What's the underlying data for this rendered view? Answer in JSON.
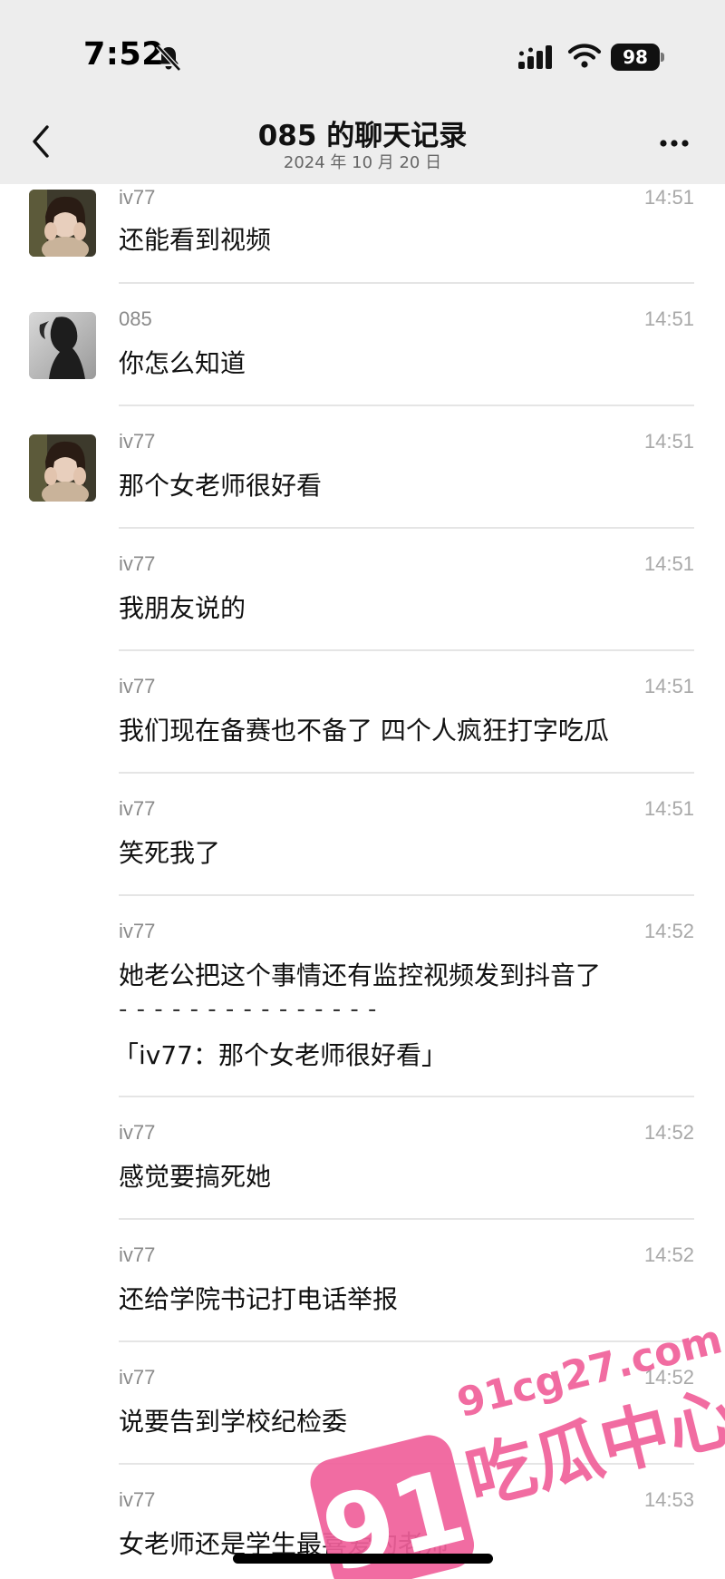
{
  "status_bar": {
    "time": "7:52",
    "battery": "98"
  },
  "header": {
    "title": "085 的聊天记录",
    "date": "2024 年 10 月 20 日"
  },
  "messages": [
    {
      "sender": "iv77",
      "time": "14:51",
      "text": "还能看到视频"
    },
    {
      "sender": "085",
      "time": "14:51",
      "text": "你怎么知道"
    },
    {
      "sender": "iv77",
      "time": "14:51",
      "text": "那个女老师很好看"
    },
    {
      "sender": "iv77",
      "time": "14:51",
      "text": "我朋友说的"
    },
    {
      "sender": "iv77",
      "time": "14:51",
      "text": "我们现在备赛也不备了 四个人疯狂打字吃瓜"
    },
    {
      "sender": "iv77",
      "time": "14:51",
      "text": "笑死我了"
    },
    {
      "sender": "iv77",
      "time": "14:52",
      "text": "她老公把这个事情还有监控视频发到抖音了",
      "dashes": "- - - - - - - - - - - - - - -",
      "quote": "「iv77：那个女老师很好看」"
    },
    {
      "sender": "iv77",
      "time": "14:52",
      "text": "感觉要搞死她"
    },
    {
      "sender": "iv77",
      "time": "14:52",
      "text": "还给学院书记打电话举报"
    },
    {
      "sender": "iv77",
      "time": "14:52",
      "text": "说要告到学校纪检委"
    },
    {
      "sender": "iv77",
      "time": "14:53",
      "text": "女老师还是学生最喜爱的老师"
    }
  ],
  "watermark": {
    "number": "91",
    "domain": "91cg27.com",
    "name": "吃瓜中心"
  },
  "colors": {
    "header_bg": "#ededed",
    "watermark_pink": "#f0609a"
  }
}
